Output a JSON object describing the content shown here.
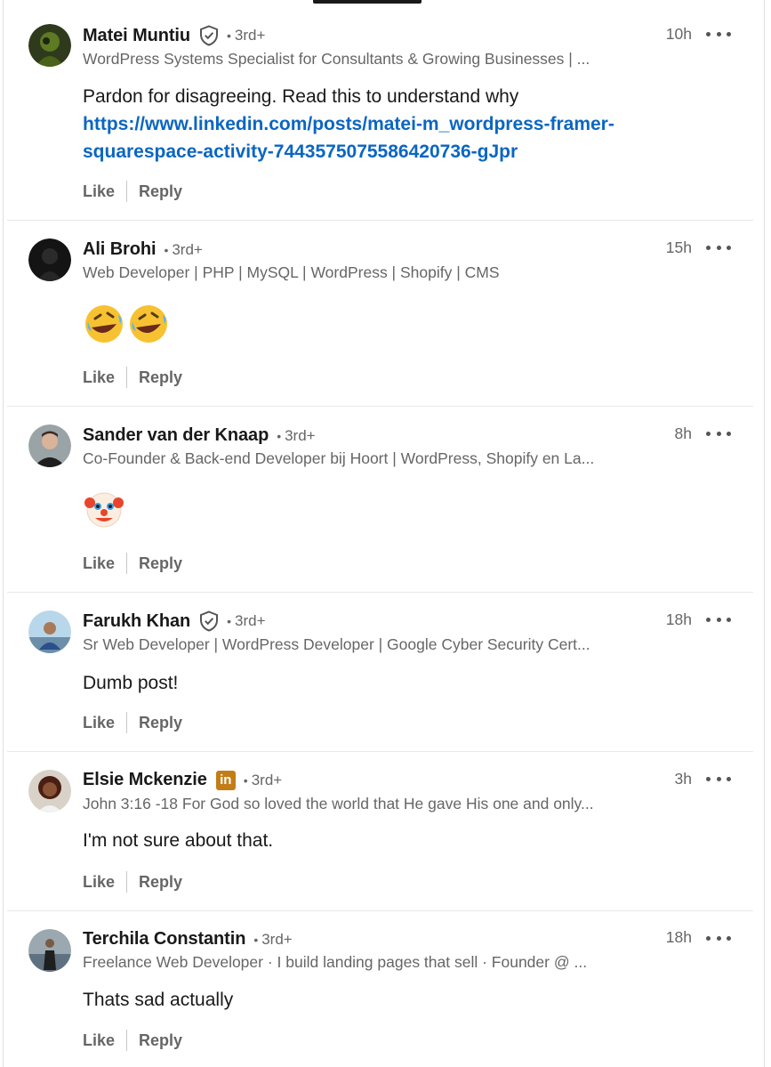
{
  "comments": [
    {
      "name": "Matei Muntiu",
      "degree": "3rd+",
      "dot": "•",
      "headline": "WordPress Systems Specialist for Consultants & Growing Businesses | ...",
      "time": "10h",
      "text": "Pardon for disagreeing. Read this to understand why",
      "link_line1": "https://www.linkedin.com/posts/matei-m_wordpress-framer-",
      "link_line2": "squarespace-activity-7443575075586420736-gJpr",
      "like": "Like",
      "reply": "Reply",
      "badge": "verified-shield-icon"
    },
    {
      "name": "Ali Brohi",
      "degree": "3rd+",
      "dot": "•",
      "headline": "Web Developer | PHP | MySQL | WordPress | Shopify | CMS",
      "time": "15h",
      "emoji": [
        "🤣",
        "🤣"
      ],
      "like": "Like",
      "reply": "Reply"
    },
    {
      "name": "Sander van der Knaap",
      "degree": "3rd+",
      "dot": "•",
      "headline": "Co-Founder & Back-end Developer bij Hoort | WordPress, Shopify en La...",
      "time": "8h",
      "emoji": [
        "🤡"
      ],
      "like": "Like",
      "reply": "Reply"
    },
    {
      "name": "Farukh Khan",
      "degree": "3rd+",
      "dot": "•",
      "headline": "Sr Web Developer | WordPress Developer | Google Cyber Security Cert...",
      "time": "18h",
      "text": "Dumb post!",
      "like": "Like",
      "reply": "Reply",
      "badge": "verified-shield-icon"
    },
    {
      "name": "Elsie Mckenzie",
      "degree": "3rd+",
      "dot": "•",
      "headline": "John 3:16 -18 For God so loved the world that He gave His one and only...",
      "time": "3h",
      "text": "I'm not sure about that.",
      "like": "Like",
      "reply": "Reply",
      "badge": "linkedin-premium-icon",
      "badge_text": "in"
    },
    {
      "name": "Terchila Constantin",
      "degree": "3rd+",
      "dot": "•",
      "headline": "Freelance Web Developer · I build landing pages that sell · Founder @ ...",
      "time": "18h",
      "text": "Thats sad actually",
      "like": "Like",
      "reply": "Reply"
    }
  ],
  "colors": {
    "link": "#0a66c2",
    "secondary_text": "#666666",
    "premium_gold": "#c37d16"
  }
}
